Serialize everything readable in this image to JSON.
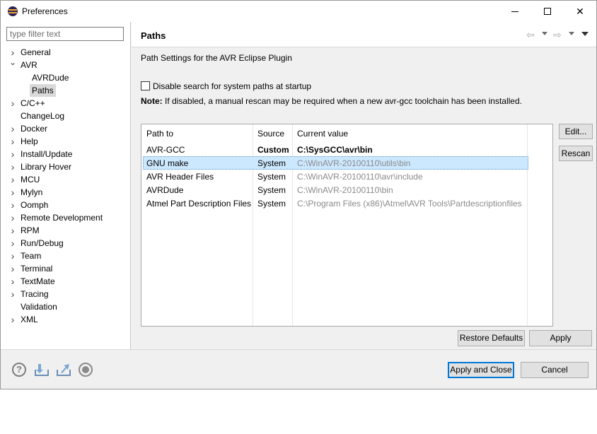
{
  "window": {
    "title": "Preferences",
    "close_glyph": "✕"
  },
  "left": {
    "filter_placeholder": "type filter text",
    "tree": [
      {
        "label": "General",
        "expanded": false,
        "level": 0,
        "has_children": true
      },
      {
        "label": "AVR",
        "expanded": true,
        "level": 0,
        "has_children": true
      },
      {
        "label": "AVRDude",
        "level": 1,
        "has_children": false
      },
      {
        "label": "Paths",
        "level": 1,
        "has_children": false,
        "selected": true
      },
      {
        "label": "C/C++",
        "expanded": false,
        "level": 0,
        "has_children": true
      },
      {
        "label": "ChangeLog",
        "level": 0,
        "has_children": false
      },
      {
        "label": "Docker",
        "expanded": false,
        "level": 0,
        "has_children": true
      },
      {
        "label": "Help",
        "expanded": false,
        "level": 0,
        "has_children": true
      },
      {
        "label": "Install/Update",
        "expanded": false,
        "level": 0,
        "has_children": true
      },
      {
        "label": "Library Hover",
        "expanded": false,
        "level": 0,
        "has_children": true
      },
      {
        "label": "MCU",
        "expanded": false,
        "level": 0,
        "has_children": true
      },
      {
        "label": "Mylyn",
        "expanded": false,
        "level": 0,
        "has_children": true
      },
      {
        "label": "Oomph",
        "expanded": false,
        "level": 0,
        "has_children": true
      },
      {
        "label": "Remote Development",
        "expanded": false,
        "level": 0,
        "has_children": true
      },
      {
        "label": "RPM",
        "expanded": false,
        "level": 0,
        "has_children": true
      },
      {
        "label": "Run/Debug",
        "expanded": false,
        "level": 0,
        "has_children": true
      },
      {
        "label": "Team",
        "expanded": false,
        "level": 0,
        "has_children": true
      },
      {
        "label": "Terminal",
        "expanded": false,
        "level": 0,
        "has_children": true
      },
      {
        "label": "TextMate",
        "expanded": false,
        "level": 0,
        "has_children": true
      },
      {
        "label": "Tracing",
        "expanded": false,
        "level": 0,
        "has_children": true
      },
      {
        "label": "Validation",
        "level": 0,
        "has_children": false
      },
      {
        "label": "XML",
        "expanded": false,
        "level": 0,
        "has_children": true
      }
    ]
  },
  "page": {
    "title": "Paths",
    "nav": {
      "back_glyph": "⇦",
      "forward_glyph": "⇨"
    },
    "description": "Path Settings for the AVR Eclipse Plugin",
    "checkbox_label": "Disable search for system paths at startup",
    "checkbox_checked": false,
    "note_bold": "Note:",
    "note_text": " If disabled, a manual rescan may be required when a new avr-gcc toolchain has been installed.",
    "table": {
      "columns": [
        "Path to",
        "Source",
        "Current value"
      ],
      "rows": [
        {
          "path": "AVR-GCC",
          "source": "Custom",
          "value": "C:\\SysGCC\\avr\\bin",
          "custom": true
        },
        {
          "path": "GNU make",
          "source": "System",
          "value": "C:\\WinAVR-20100110\\utils\\bin",
          "selected": true
        },
        {
          "path": "AVR Header Files",
          "source": "System",
          "value": "C:\\WinAVR-20100110\\avr\\include"
        },
        {
          "path": "AVRDude",
          "source": "System",
          "value": "C:\\WinAVR-20100110\\bin"
        },
        {
          "path": "Atmel Part Description Files",
          "source": "System",
          "value": "C:\\Program Files (x86)\\Atmel\\AVR Tools\\Partdescriptionfiles"
        }
      ]
    },
    "buttons": {
      "edit": "Edit...",
      "rescan": "Rescan",
      "restore_defaults": "Restore Defaults",
      "apply": "Apply"
    }
  },
  "footer": {
    "help_glyph": "?",
    "apply_close": "Apply and Close",
    "cancel": "Cancel"
  }
}
